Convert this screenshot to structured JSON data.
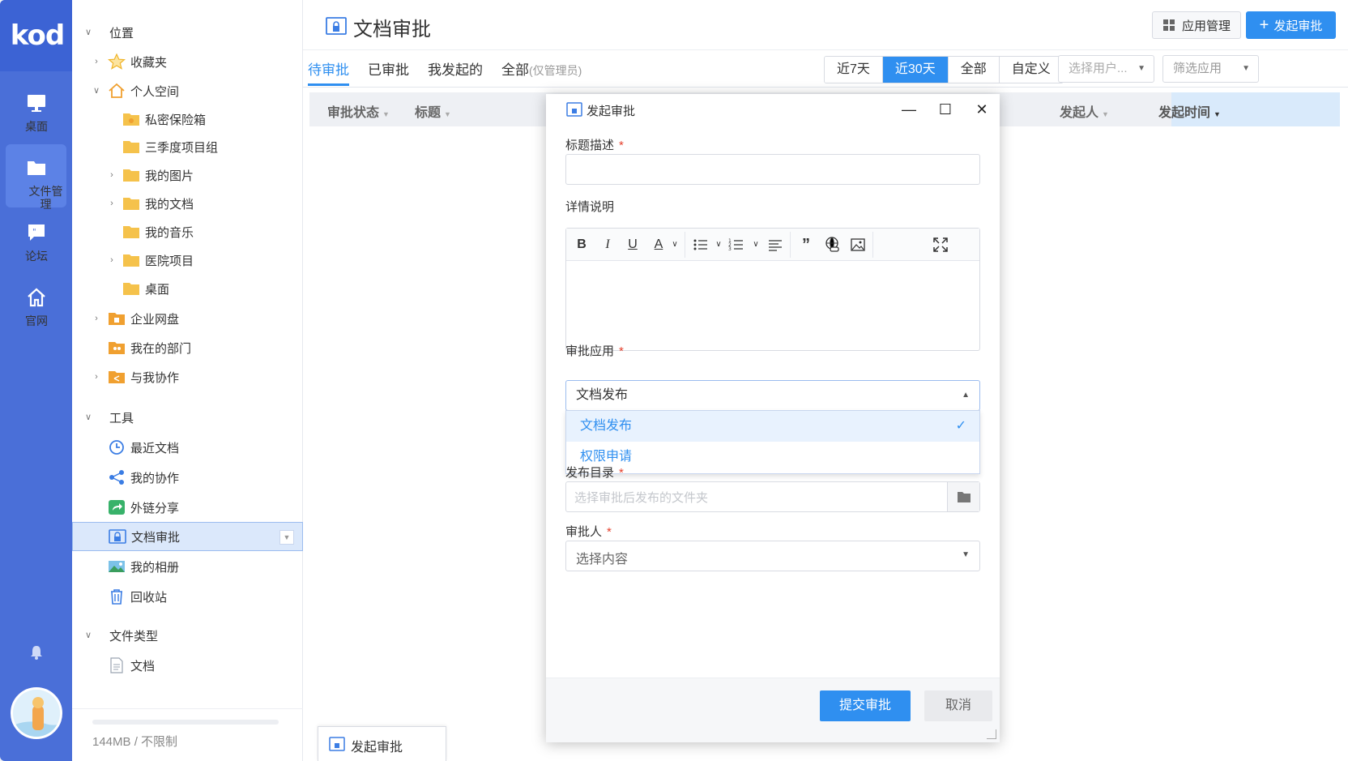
{
  "rail": {
    "logo": "kod",
    "items": [
      {
        "label": "桌面",
        "icon": "desktop-icon"
      },
      {
        "label": "文件管理",
        "icon": "folder-icon"
      },
      {
        "label": "论坛",
        "icon": "chat-icon"
      },
      {
        "label": "官网",
        "icon": "home-icon"
      }
    ]
  },
  "tree": {
    "location": "位置",
    "favorites": "收藏夹",
    "personal": "个人空间",
    "vault": "私密保险箱",
    "q3": "三季度项目组",
    "pictures": "我的图片",
    "docs": "我的文档",
    "music": "我的音乐",
    "hospital": "医院项目",
    "desktop": "桌面",
    "enterprise": "企业网盘",
    "dept": "我在的部门",
    "collab_with_me": "与我协作",
    "tools": "工具",
    "recent": "最近文档",
    "my_collab": "我的协作",
    "share": "外链分享",
    "approval": "文档审批",
    "album": "我的相册",
    "recycle": "回收站",
    "filetypes": "文件类型",
    "doc": "文档",
    "storage": "144MB / 不限制"
  },
  "header": {
    "title": "文档审批",
    "app_manage": "应用管理",
    "new_approval": "发起审批"
  },
  "tabs": [
    {
      "label": "待审批"
    },
    {
      "label": "已审批"
    },
    {
      "label": "我发起的"
    },
    {
      "label": "全部",
      "note": "(仅管理员)"
    }
  ],
  "ranges": [
    "近7天",
    "近30天",
    "全部",
    "自定义"
  ],
  "filters": {
    "user_placeholder": "选择用户...",
    "app_placeholder": "筛选应用"
  },
  "table": {
    "columns": [
      "审批状态",
      "标题",
      "发起人",
      "发起时间"
    ]
  },
  "dialog": {
    "title": "发起审批",
    "f_title": "标题描述",
    "f_detail": "详情说明",
    "f_app": "审批应用",
    "app_value": "文档发布",
    "options": [
      "文档发布",
      "权限申请"
    ],
    "f_dir": "发布目录",
    "dir_placeholder": "选择审批后发布的文件夹",
    "f_approver": "审批人",
    "approver_placeholder": "选择内容",
    "submit": "提交审批",
    "cancel": "取消",
    "required_mark": "*",
    "toolbar": {
      "bold": "B",
      "italic": "I",
      "underline": "U",
      "color": "A"
    }
  },
  "taskbar": {
    "item": "发起审批"
  },
  "colors": {
    "rail": "#4a6fd8",
    "accent": "#2f8ff0",
    "required": "#e5412d"
  }
}
